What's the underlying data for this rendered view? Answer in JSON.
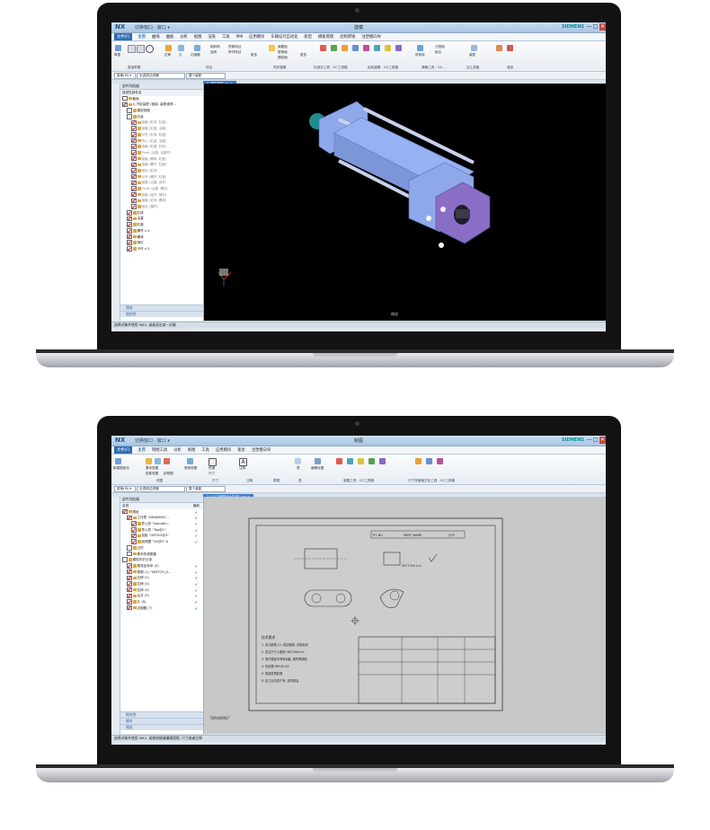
{
  "top_laptop": {
    "app_logo": "NX",
    "quick_access": "切换窗口 · 窗口 ▾",
    "window_title": "建模",
    "brand": "SIEMENS",
    "window_buttons": [
      "—",
      "□",
      "✕"
    ],
    "menu": [
      "文件(F)",
      "主页",
      "曲线",
      "曲面",
      "分析",
      "视图",
      "渲染",
      "工具",
      "PMI",
      "应用模块",
      "车辆设计自动化",
      "船型",
      "模板管理",
      "结构焊接",
      "注塑模向导"
    ],
    "ribbon_small": [
      "草图",
      "拉伸",
      "孔",
      "边倒圆",
      "倒斜角",
      "抽壳",
      "镜像特征",
      "阵列特征",
      "更多",
      "偏置面",
      "替换面",
      "删除面",
      "更多",
      "修剪体",
      "分割面",
      "组合",
      "装配"
    ],
    "ribbon_groups": [
      "直接草图",
      "特征",
      "同步建模",
      "标准化工具 - GC工具箱",
      "齿轮建模 - GC工具箱",
      "弹簧工具 - GC...",
      "加工准备",
      "渲染"
    ],
    "filter_select": "菜单(M) ▾",
    "filter_value": "无选择过滤器",
    "assembly_value": "整个装配",
    "doc_tab": "4_汽缸装配.prt ✕",
    "nav_header": "部件导航器",
    "tree_header": "描述性部件名",
    "tree": [
      {
        "indent": 0,
        "cb": false,
        "text": "截面",
        "gray": false
      },
      {
        "indent": 0,
        "cb": true,
        "text": "4_汽缸装配 (链接: 装配维修...",
        "gray": false
      },
      {
        "indent": 1,
        "cb": false,
        "text": "模型视图",
        "gray": false
      },
      {
        "indent": 1,
        "cb": false,
        "text": "约束",
        "gray": false
      },
      {
        "indent": 2,
        "cb": true,
        "text": "接触 (缸体, 缸盖)",
        "gray": true
      },
      {
        "indent": 2,
        "cb": true,
        "text": "接触 (缸盖, 活塞)",
        "gray": true
      },
      {
        "indent": 2,
        "cb": true,
        "text": "对齐 (缸体, 缸盖)",
        "gray": true
      },
      {
        "indent": 2,
        "cb": true,
        "text": "同心 (缸盖, 活塞)",
        "gray": true
      },
      {
        "indent": 2,
        "cb": true,
        "text": "接触 (缸盖, 缸体)",
        "gray": true
      },
      {
        "indent": 2,
        "cb": true,
        "text": "Pivot (活塞, 活塞杆)",
        "gray": true
      },
      {
        "indent": 2,
        "cb": true,
        "text": "接触 (螺母, 缸盖)",
        "gray": true
      },
      {
        "indent": 2,
        "cb": true,
        "text": "接触 (螺杆, 缸盖)",
        "gray": true
      },
      {
        "indent": 2,
        "cb": true,
        "text": "固定 (缸体)",
        "gray": true
      },
      {
        "indent": 2,
        "cb": true,
        "text": "对齐 (螺杆, 缸盖)",
        "gray": true
      },
      {
        "indent": 2,
        "cb": true,
        "text": "接触 (活塞, 连杆)",
        "gray": true
      },
      {
        "indent": 2,
        "cb": true,
        "text": "Pivot (活塞, 螺柱)",
        "gray": true
      },
      {
        "indent": 2,
        "cb": true,
        "text": "接触 (连杆, 销钉)",
        "gray": true
      },
      {
        "indent": 2,
        "cb": true,
        "text": "接触 (缸体, 螺母)",
        "gray": true
      },
      {
        "indent": 2,
        "cb": true,
        "text": "固定 (螺杆)",
        "gray": true
      },
      {
        "indent": 1,
        "cb": true,
        "text": "缸体",
        "gray": false
      },
      {
        "indent": 1,
        "cb": true,
        "text": "活塞",
        "gray": false
      },
      {
        "indent": 1,
        "cb": true,
        "text": "缸盖",
        "gray": false
      },
      {
        "indent": 1,
        "cb": true,
        "text": "螺杆 x 4",
        "gray": false
      },
      {
        "indent": 1,
        "cb": true,
        "text": "螺母",
        "gray": false
      },
      {
        "indent": 1,
        "cb": true,
        "text": "销钉",
        "gray": false
      },
      {
        "indent": 1,
        "cb": true,
        "text": "卡环 x 2",
        "gray": false
      }
    ],
    "accordion": [
      "预览",
      "相关性"
    ],
    "statusbar": "选择对象并使用 MB3, 或者双击某一对象",
    "viewport_label": "缩放"
  },
  "bottom_laptop": {
    "app_logo": "NX",
    "quick_access": "切换窗口 · 窗口 ▾",
    "window_title": "制图",
    "brand": "SIEMENS",
    "window_buttons": [
      "—",
      "□",
      "✕"
    ],
    "menu": [
      "文件(F)",
      "主页",
      "制图工具",
      "分析",
      "视图",
      "工具",
      "应用模块",
      "钣金",
      "注塑模向导"
    ],
    "ribbon_small": [
      "新建图纸页",
      "视图",
      "更新视图",
      "尺寸",
      "注释",
      "表",
      "编辑设置",
      "快速",
      "基本视图",
      "投影视图",
      "剖视图"
    ],
    "ribbon_groups": [
      "视图",
      "尺寸",
      "注释",
      "草图",
      "表",
      "制图工具 - GC工具箱",
      "尺寸快速格式化工具 - GC工具箱"
    ],
    "filter_select": "菜单(M) ▾",
    "filter_value": "无选择过滤器",
    "assembly_value": "整个装配",
    "doc_tab": "3_5-8工程图设计实例1.prt ✕",
    "nav_header": "部件导航器",
    "col_name": "名称",
    "col_status": "最新",
    "tree": [
      {
        "indent": 0,
        "cb": true,
        "text": "图纸",
        "check": true
      },
      {
        "indent": 1,
        "cb": true,
        "text": "工作表 \"DRAWING\"...",
        "check": true
      },
      {
        "indent": 2,
        "cb": true,
        "text": "导入的 \"Isometri...",
        "check": true
      },
      {
        "indent": 2,
        "cb": true,
        "text": "导入的 \"Top@1\"",
        "check": true
      },
      {
        "indent": 2,
        "cb": true,
        "text": "投影 \"ORTHO@3\"",
        "check": true
      },
      {
        "indent": 2,
        "cb": true,
        "text": "剖视图 \"SX@5\" A",
        "check": true
      },
      {
        "indent": 1,
        "cb": false,
        "text": "过时",
        "check": false
      },
      {
        "indent": 1,
        "cb": false,
        "text": "基本的视图集",
        "check": false
      },
      {
        "indent": 0,
        "cb": false,
        "text": "模型历史记录",
        "check": false
      },
      {
        "indent": 1,
        "cb": true,
        "text": "基准坐标系 (0)",
        "check": true
      },
      {
        "indent": 1,
        "cb": true,
        "text": "草图 (1) \"SKETCH_0...",
        "check": true
      },
      {
        "indent": 1,
        "cb": true,
        "text": "拉伸 (2)",
        "check": true
      },
      {
        "indent": 1,
        "cb": true,
        "text": "拉伸 (3)",
        "check": true
      },
      {
        "indent": 1,
        "cb": true,
        "text": "拉伸 (4)",
        "check": true
      },
      {
        "indent": 1,
        "cb": true,
        "text": "合并 (5)",
        "check": true
      },
      {
        "indent": 1,
        "cb": true,
        "text": "孔 (6)",
        "check": true
      },
      {
        "indent": 1,
        "cb": true,
        "text": "边倒圆 (7)",
        "check": true
      }
    ],
    "accordion": [
      "相关性",
      "细节",
      "预览"
    ],
    "sheet_name": "\"DRAWING\"",
    "statusbar": "选择对象并使用 MB3, 或按快捷键编辑视图, 尺寸或者注释",
    "drawing": {
      "title_block_top": [
        "P1  NO",
        "PART NAME",
        "QTY"
      ],
      "tech_title": "技术要求",
      "tech_notes": [
        "1. 未注倒角 C1, 锐边倒钝, 去除毛刺",
        "2. 未注尺寸公差按 GB/T1804-m",
        "3. 零件表面不得有划痕, 擦伤等缺陷",
        "4. 热处理 HRC40-45",
        "5. 表面发黑处理",
        "6. 加工后清洗干净, 涂防锈油"
      ],
      "section_label": "SECTION A-A"
    }
  }
}
